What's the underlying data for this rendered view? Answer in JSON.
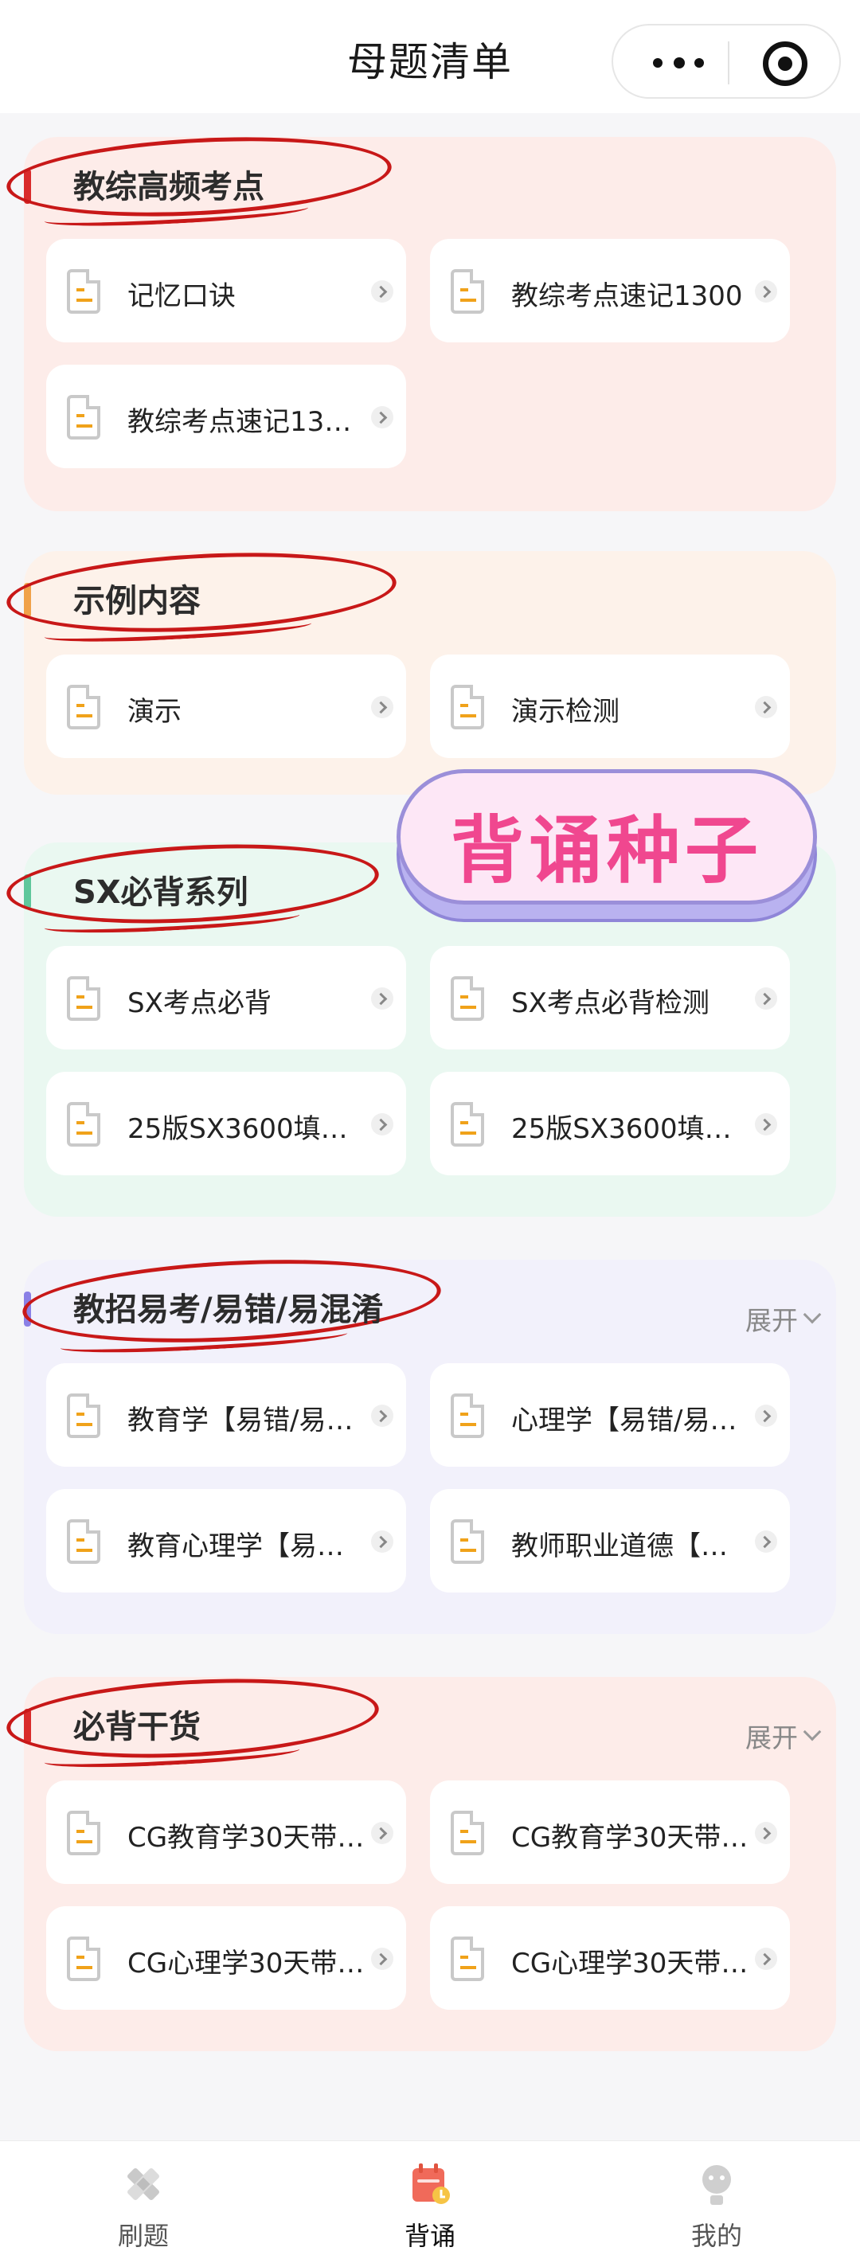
{
  "header": {
    "title": "母题清单"
  },
  "sections": [
    {
      "title": "教综高频考点",
      "expand": "",
      "items": [
        "记忆口诀",
        "教综考点速记1300",
        "教综考点速记13…"
      ]
    },
    {
      "title": "示例内容",
      "expand": "",
      "items": [
        "演示",
        "演示检测"
      ]
    },
    {
      "title": "SX必背系列",
      "expand": "",
      "items": [
        "SX考点必背",
        "SX考点必背检测",
        "25版SX3600填…",
        "25版SX3600填…"
      ]
    },
    {
      "title": "教招易考/易错/易混淆",
      "expand": "展开",
      "items": [
        "教育学【易错/易…",
        "心理学【易错/易…",
        "教育心理学【易…",
        "教师职业道德【…"
      ]
    },
    {
      "title": "必背干货",
      "expand": "展开",
      "items": [
        "CG教育学30天带…",
        "CG教育学30天带…",
        "CG心理学30天带…",
        "CG心理学30天带…"
      ]
    }
  ],
  "sticker": {
    "text": "背诵种子"
  },
  "tabbar": {
    "items": [
      {
        "label": "刷题",
        "icon": "pencil-ruler-icon"
      },
      {
        "label": "背诵",
        "icon": "calendar-bookmark-icon",
        "active": true
      },
      {
        "label": "我的",
        "icon": "user-icon"
      }
    ]
  },
  "colors": {
    "accent_red": "#d92b2b",
    "accent_orange": "#f0a24a",
    "accent_green": "#5fc79c",
    "accent_purple": "#8a80e6",
    "section_bg_1": "#fdece9",
    "section_bg_2": "#fdf2ea",
    "section_bg_3": "#eaf8f1",
    "section_bg_4": "#f2f1fb",
    "sticker_text": "#f0478f"
  }
}
